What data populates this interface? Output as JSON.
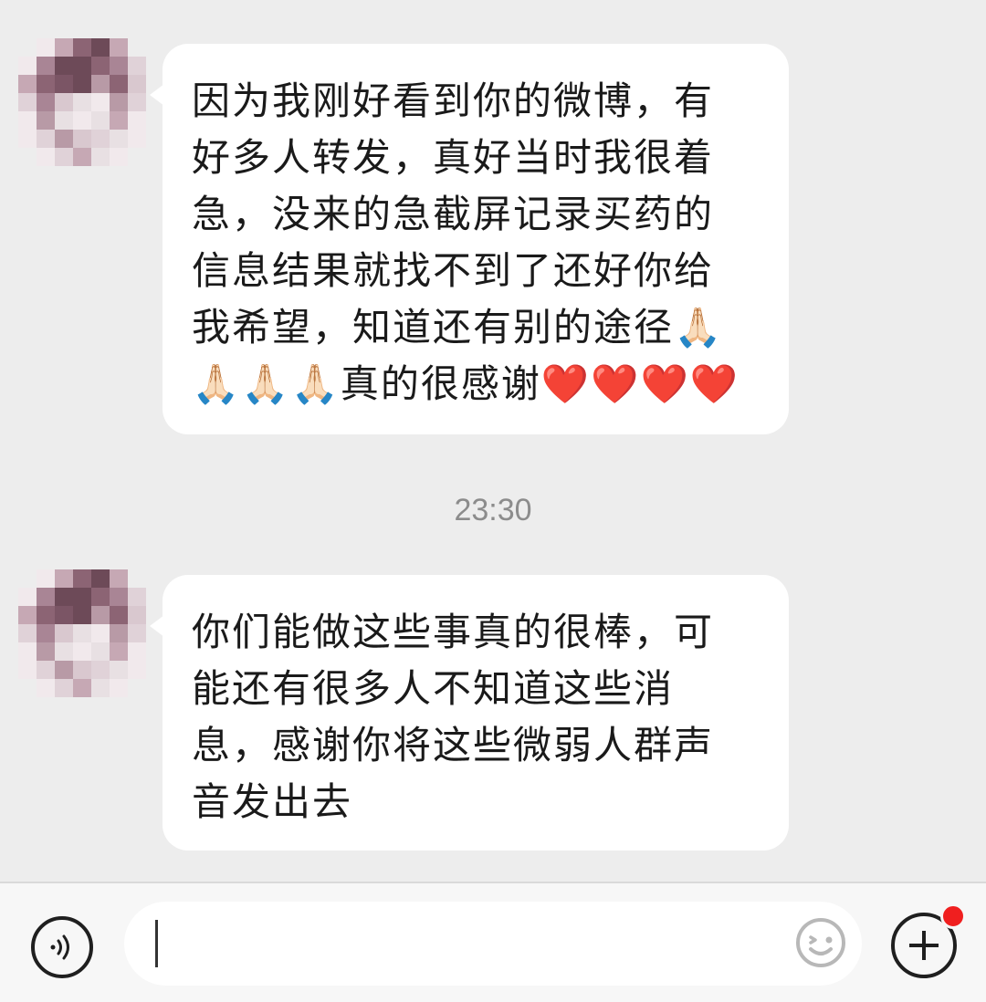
{
  "messages": [
    {
      "lines": [
        "因为我刚好看到你的微博，有",
        "好多人转发，真好当时我很着",
        "急，没来的急截屏记录买药的",
        "信息结果就找不到了还好你给",
        "我希望，知道还有别的途径🙏🏻",
        "🙏🏻🙏🏻🙏🏻真的很感谢❤️❤️❤️❤️"
      ]
    },
    {
      "lines": [
        "你们能做这些事真的很棒，可",
        "能还有很多人不知道这些消",
        "息，感谢你将这些微弱人群声",
        "音发出去"
      ]
    }
  ],
  "timestamp": "23:30",
  "input": {
    "value": "",
    "placeholder": ""
  },
  "icons": {
    "voice": "voice-wave-icon",
    "emoji": "emoji-smile-icon",
    "plus": "plus-circle-icon"
  },
  "colors": {
    "background": "#ededed",
    "bubble": "#ffffff",
    "notification": "#f01f1f"
  },
  "notification_badge": true
}
